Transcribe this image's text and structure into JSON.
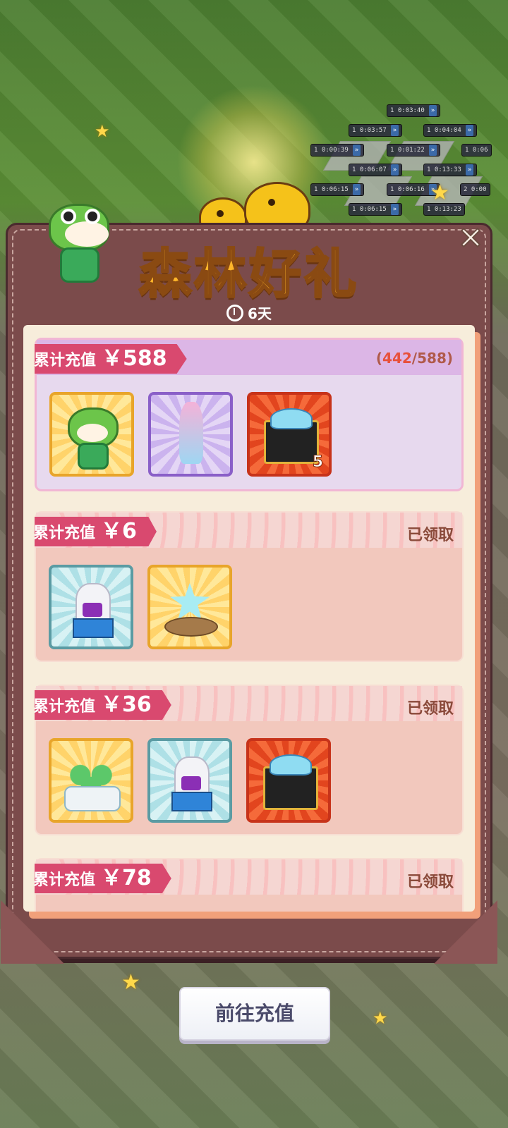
{
  "event": {
    "title": "森林好礼",
    "remaining": "6天",
    "close_label": "✕"
  },
  "background_timers": [
    {
      "count": "1",
      "time": "0:03:40"
    },
    {
      "count": "1",
      "time": "0:03:57"
    },
    {
      "count": "1",
      "time": "0:04:04"
    },
    {
      "count": "1",
      "time": "0:00:39"
    },
    {
      "count": "1",
      "time": "0:01:22"
    },
    {
      "count": "1",
      "time": "0:06"
    },
    {
      "count": "1",
      "time": "0:06:07"
    },
    {
      "count": "1",
      "time": "0:13:33"
    },
    {
      "count": "1",
      "time": "0:06:15"
    },
    {
      "count": "1",
      "time": "0:06:16"
    },
    {
      "count": "2",
      "time": "0:00"
    },
    {
      "count": "1",
      "time": "0:06:15"
    },
    {
      "count": "1",
      "time": "0:13:23"
    }
  ],
  "tiers": [
    {
      "label": "累计充值",
      "amount": "￥588",
      "progress_current": "442",
      "progress_total": "588",
      "state": "in_progress",
      "items": [
        {
          "icon": "frog-mascot-icon",
          "frame": "gold",
          "qty": ""
        },
        {
          "icon": "fairy-costume-icon",
          "frame": "purple",
          "qty": ""
        },
        {
          "icon": "diamond-chest-icon",
          "frame": "red",
          "qty": "5"
        }
      ]
    },
    {
      "label": "累计充值",
      "amount": "￥6",
      "status": "已领取",
      "state": "claimed",
      "items": [
        {
          "icon": "potion-bag-icon",
          "frame": "blue",
          "qty": ""
        },
        {
          "icon": "star-rock-icon",
          "frame": "gold",
          "qty": ""
        }
      ]
    },
    {
      "label": "累计充值",
      "amount": "￥36",
      "status": "已领取",
      "state": "claimed",
      "items": [
        {
          "icon": "frog-bundle-icon",
          "frame": "gold",
          "qty": ""
        },
        {
          "icon": "potion-bag-icon",
          "frame": "blue",
          "qty": ""
        },
        {
          "icon": "diamond-chest-icon",
          "frame": "red",
          "qty": ""
        }
      ]
    },
    {
      "label": "累计充值",
      "amount": "￥78",
      "status": "已领取",
      "state": "claimed",
      "items": [
        {
          "icon": "item-gold-icon",
          "frame": "gold",
          "qty": ""
        },
        {
          "icon": "item-purple-icon",
          "frame": "purple",
          "qty": ""
        },
        {
          "icon": "item-red-icon",
          "frame": "red",
          "qty": ""
        }
      ]
    }
  ],
  "footer": {
    "go_recharge_label": "前往充值"
  },
  "colors": {
    "panel": "#7b4b4b",
    "title": "#ffb62a",
    "ribbon": "#d9496f",
    "progress_current": "#e8503a"
  }
}
